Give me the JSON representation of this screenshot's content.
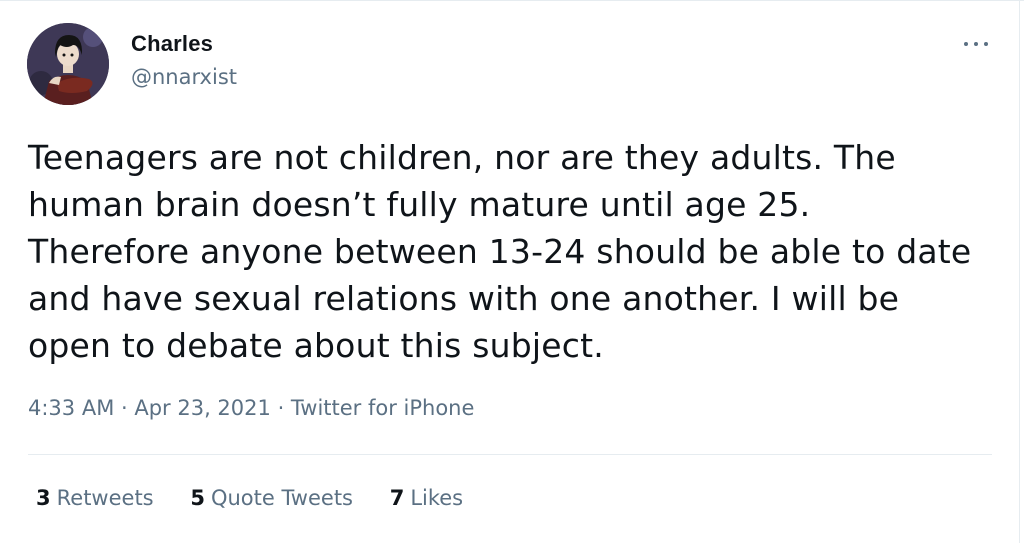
{
  "author": {
    "name": "Charles",
    "handle": "@nnarxist",
    "avatar_icon": "cartoon-character-avatar"
  },
  "tweet": {
    "text": "Teenagers are not children, nor are they adults. The human brain doesn’t fully mature until age 25. Therefore anyone between 13-24 should be able to date and have sexual relations with one another. I will be open to debate about this subject.",
    "time": "4:33 AM",
    "date": "Apr 23, 2021",
    "source": "Twitter for iPhone",
    "separator": " · "
  },
  "menu": {
    "icon": "more-options-icon"
  },
  "stats": {
    "retweets_count": "3",
    "retweets_label": "Retweets",
    "quote_tweets_count": "5",
    "quote_tweets_label": "Quote Tweets",
    "likes_count": "7",
    "likes_label": "Likes"
  },
  "colors": {
    "text_primary": "#0f1419",
    "text_secondary": "#5b7083",
    "border": "#e6ecf0"
  }
}
